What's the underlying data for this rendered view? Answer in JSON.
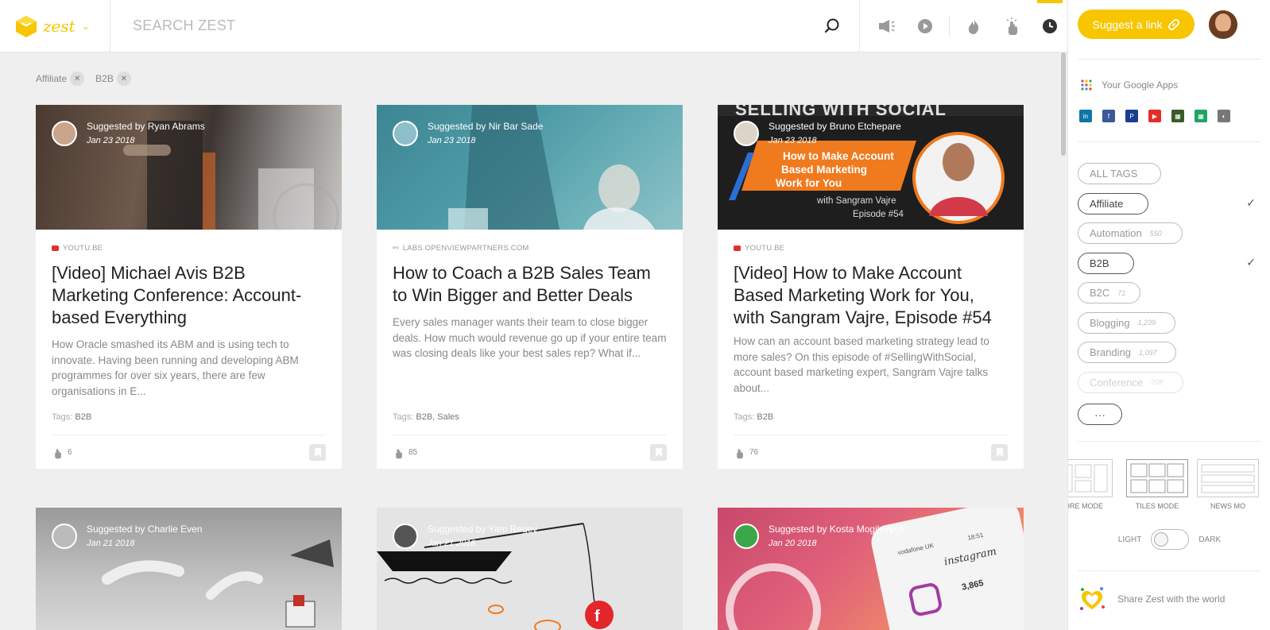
{
  "app": {
    "logo_text": "zest",
    "accent_color": "#f7c600"
  },
  "search": {
    "placeholder": "SEARCH ZEST"
  },
  "header_icons": [
    "megaphone-icon",
    "play-icon",
    "fire-icon",
    "pointer-icon",
    "clock-icon"
  ],
  "filters": [
    {
      "label": "Affiliate"
    },
    {
      "label": "B2B"
    }
  ],
  "cards": [
    {
      "suggested_by": "Suggested by Ryan Abrams",
      "date": "Jan 23 2018",
      "source": "YOUTU.BE",
      "title": "[Video] Michael Avis B2B Marketing Conference: Account-based Everything",
      "description": "How Oracle smashed its ABM and is using tech to innovate. Having been running and developing ABM programmes for over six years, there are few organisations in E...",
      "tags_label": "Tags:",
      "tags": "B2B",
      "likes": "6"
    },
    {
      "suggested_by": "Suggested by Nir Bar Sade",
      "date": "Jan 23 2018",
      "source": "LABS.OPENVIEWPARTNERS.COM",
      "title": "How to Coach a B2B Sales Team to Win Bigger and Better Deals",
      "description": "Every sales manager wants their team to close bigger deals. How much would revenue go up if your entire team was closing deals like your best sales rep? What if...",
      "tags_label": "Tags:",
      "tags": "B2B, Sales",
      "likes": "85"
    },
    {
      "suggested_by": "Suggested by Bruno Etchepare",
      "date": "Jan 23 2018",
      "source": "YOUTU.BE",
      "title": "[Video] How to Make Account Based Marketing Work for You, with Sangram Vajre, Episode #54",
      "description": "How can an account based marketing strategy lead to more sales? On this episode of #SellingWithSocial, account based marketing expert, Sangram Vajre talks about...",
      "tags_label": "Tags:",
      "tags": "B2B",
      "likes": "76",
      "image_text": {
        "banner": "SELLING WITH SOCIAL",
        "line1": "How to Make Account",
        "line2": "Based Marketing",
        "line3": "Work for You",
        "guest": "with Sangram Vajre",
        "episode": "Episode #54"
      }
    },
    {
      "suggested_by": "Suggested by Charlie Even",
      "date": "Jan 21 2018"
    },
    {
      "suggested_by": "Suggested by Yam Regev",
      "date": "Jan 21 2018"
    },
    {
      "suggested_by": "Suggested by Kosta Mogilevych",
      "date": "Jan 20 2018",
      "image_text": {
        "carrier": "vodafone UK",
        "time": "18:51",
        "app": "instagram",
        "count": "3,865"
      }
    }
  ],
  "sidebar": {
    "suggest_label": "Suggest a link",
    "google_apps_label": "Your Google Apps",
    "apps": [
      {
        "name": "linkedin-icon",
        "color": "#0e76a8",
        "glyph": "in"
      },
      {
        "name": "facebook-icon",
        "color": "#3b5998",
        "glyph": "f"
      },
      {
        "name": "paypal-icon",
        "color": "#1a3d8f",
        "glyph": "P"
      },
      {
        "name": "youtube-icon",
        "color": "#e52d27",
        "glyph": "▶"
      },
      {
        "name": "sheets-dark-icon",
        "color": "#3a5a2a",
        "glyph": "▦"
      },
      {
        "name": "sheets-icon",
        "color": "#1fa463",
        "glyph": "▦"
      },
      {
        "name": "chrome-icon",
        "color": "#777",
        "glyph": "◐"
      }
    ],
    "tags": [
      {
        "label": "ALL TAGS",
        "count": "",
        "selected": false,
        "faded": false
      },
      {
        "label": "Affiliate",
        "count": "",
        "selected": true,
        "faded": false
      },
      {
        "label": "Automation",
        "count": "550",
        "selected": false,
        "faded": false
      },
      {
        "label": "B2B",
        "count": "",
        "selected": true,
        "faded": false
      },
      {
        "label": "B2C",
        "count": "71",
        "selected": false,
        "faded": false
      },
      {
        "label": "Blogging",
        "count": "1,239",
        "selected": false,
        "faded": false
      },
      {
        "label": "Branding",
        "count": "1,097",
        "selected": false,
        "faded": false
      },
      {
        "label": "Conference",
        "count": "208",
        "selected": false,
        "faded": true
      }
    ],
    "more_label": "···",
    "modes": [
      {
        "label": "LORE MODE",
        "active": false
      },
      {
        "label": "TILES MODE",
        "active": true
      },
      {
        "label": "NEWS MO",
        "active": false
      }
    ],
    "theme": {
      "light": "LIGHT",
      "dark": "DARK"
    },
    "share_label": "Share Zest with the world"
  }
}
